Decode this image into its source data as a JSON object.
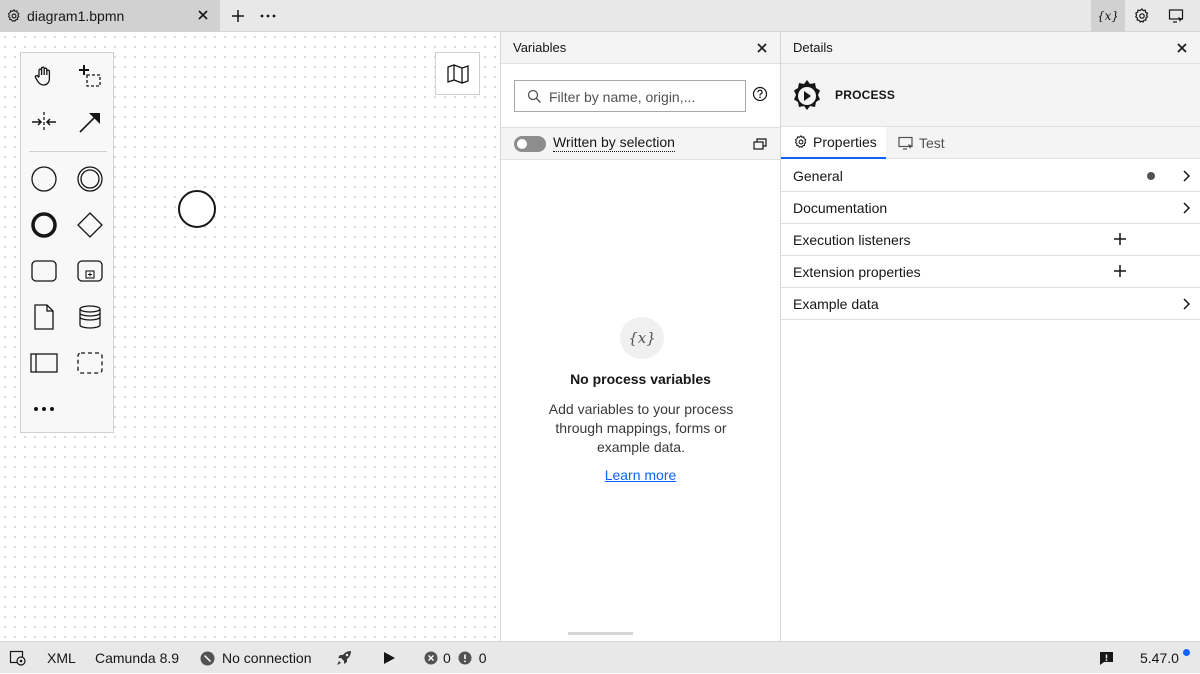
{
  "tab": {
    "title": "diagram1.bpmn"
  },
  "variables": {
    "title": "Variables",
    "search_placeholder": "Filter by name, origin,...",
    "toggle_label": "Written by selection",
    "empty": {
      "icon_text": "{x}",
      "title": "No process variables",
      "text": "Add variables to your process through mappings, forms or example data.",
      "link": "Learn more"
    }
  },
  "details": {
    "title": "Details",
    "element_type": "PROCESS",
    "tabs": [
      {
        "label": "Properties",
        "icon": "gear-icon"
      },
      {
        "label": "Test",
        "icon": "monitor-icon"
      }
    ],
    "groups": [
      {
        "label": "General",
        "action": "chevron",
        "has_dot": true
      },
      {
        "label": "Documentation",
        "action": "chevron",
        "has_dot": false
      },
      {
        "label": "Execution listeners",
        "action": "plus",
        "has_dot": false
      },
      {
        "label": "Extension properties",
        "action": "plus",
        "has_dot": false
      },
      {
        "label": "Example data",
        "action": "chevron",
        "has_dot": false
      }
    ]
  },
  "palette": {
    "tools": [
      "hand-tool",
      "lasso-tool",
      "space-tool",
      "global-connect-tool",
      "start-event",
      "intermediate-event",
      "end-event",
      "gateway",
      "task",
      "subprocess",
      "data-object",
      "data-store",
      "pool",
      "group",
      "more"
    ]
  },
  "statusbar": {
    "xml": "XML",
    "engine": "Camunda 8.9",
    "connection": "No connection",
    "errors": "0",
    "warnings": "0",
    "version": "5.47.0"
  },
  "colors": {
    "accent": "#0f62fe",
    "text": "#161616",
    "panel_bg": "#f4f4f4",
    "bar_bg": "#e8e8e8"
  }
}
